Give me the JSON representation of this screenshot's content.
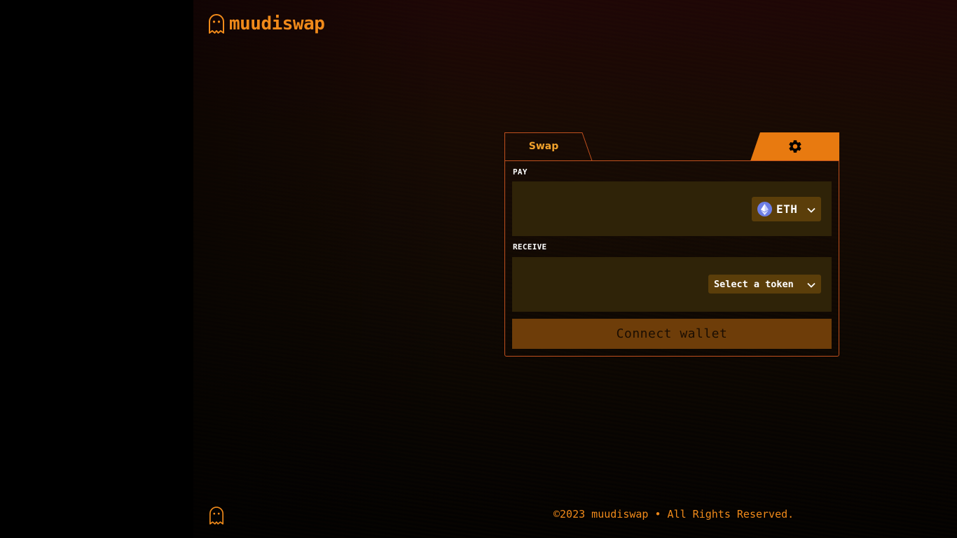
{
  "brand": {
    "name": "muudiswap",
    "accent": "#f08a1a",
    "logo_icon": "ghost-icon"
  },
  "tabs": {
    "swap_label": "Swap",
    "settings_icon": "gear-icon"
  },
  "pay": {
    "label": "PAY",
    "token": "ETH",
    "token_icon": "ethereum-icon"
  },
  "receive": {
    "label": "RECEIVE",
    "token_select": "Select a token"
  },
  "connect_button": "Connect wallet",
  "footer": {
    "copyright": "©2023 muudiswap • All Rights Reserved."
  },
  "colors": {
    "panel_border": "#c0501e",
    "field_bg": "#2f2308",
    "token_bg": "#5b3e0a",
    "connect_bg": "#6e3d09",
    "settings_tab": "#e87a10"
  }
}
